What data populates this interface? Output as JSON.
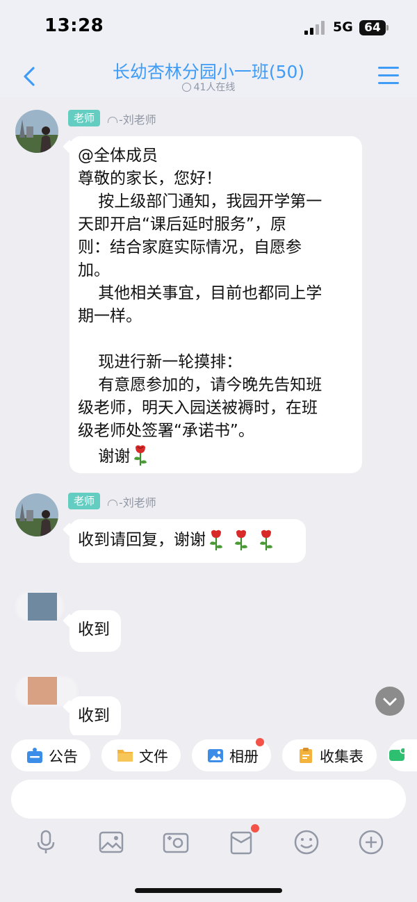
{
  "status_bar": {
    "time": "13:28",
    "network": "5G",
    "battery": "64"
  },
  "header": {
    "title": "长幼杏林分园小一班(50)",
    "online": "41人在线"
  },
  "messages": [
    {
      "badge": "老师",
      "sender": "-刘老师",
      "lines": [
        "@全体成员",
        "尊敬的家长，您好！",
        "    按上级部门通知，我园开学第一",
        "天即开启“课后延时服务”，原",
        "则：结合家庭实际情况，自愿参",
        "加。",
        "    其他相关事宜，目前也都同上学",
        "期一样。",
        "",
        "    现进行新一轮摸排：",
        "    有意愿参加的，请今晚先告知班",
        "级老师，明天入园送被褥时，在班",
        "级老师处签署“承诺书”。",
        "    谢谢"
      ]
    },
    {
      "badge": "老师",
      "sender": "-刘老师",
      "text": "收到请回复，谢谢"
    },
    {
      "text": "收到"
    },
    {
      "text": "收到"
    }
  ],
  "toolbar": {
    "chips": [
      "公告",
      "文件",
      "相册",
      "收集表"
    ]
  },
  "icons": [
    "microphone-icon",
    "image-icon",
    "camera-icon",
    "red-packet-icon",
    "emoji-icon",
    "plus-icon"
  ],
  "colors": {
    "accent": "#3f9cf6",
    "badge": "#63cdc2",
    "background": "#ededf2",
    "notification": "#f25247"
  }
}
